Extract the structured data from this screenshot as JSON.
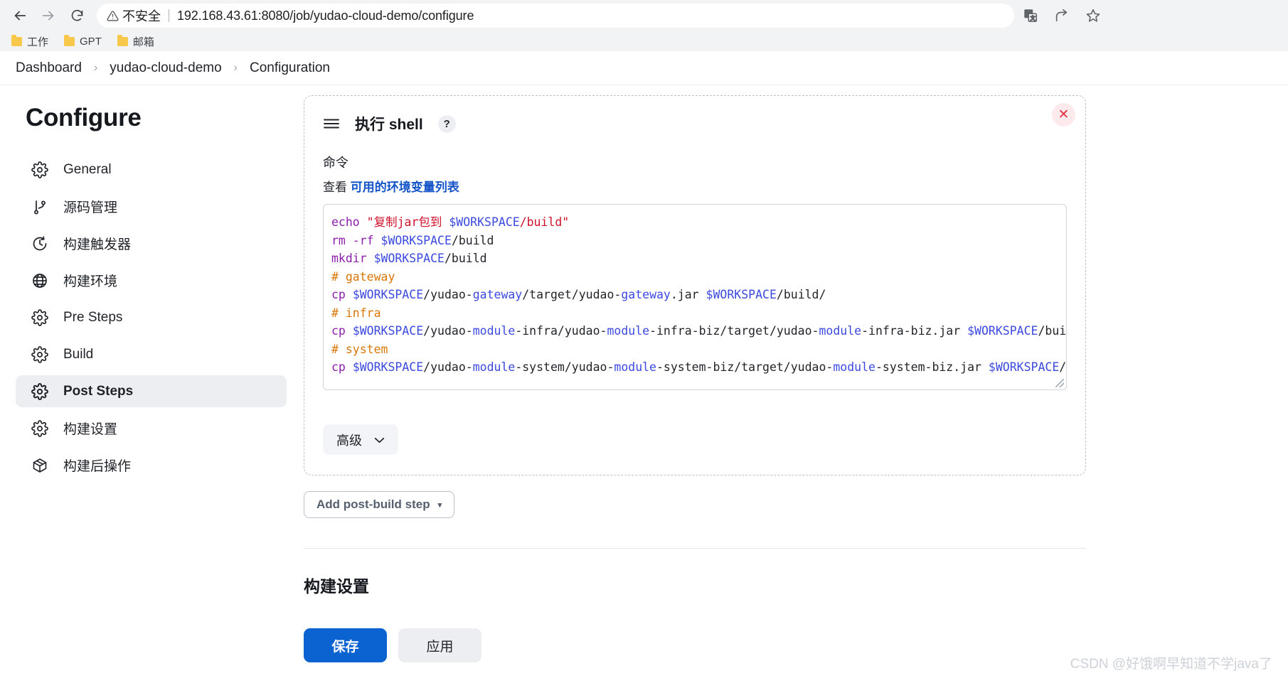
{
  "browser": {
    "back_icon": "back-arrow-icon",
    "forward_icon": "forward-arrow-icon",
    "reload_icon": "reload-icon",
    "security_label": "不安全",
    "url": "192.168.43.61:8080/job/yudao-cloud-demo/configure",
    "separator": "|",
    "actions": [
      {
        "name": "translate-icon",
        "glyph": "translate"
      },
      {
        "name": "share-icon",
        "glyph": "share"
      },
      {
        "name": "bookmark-star-icon",
        "glyph": "star"
      }
    ],
    "bookmarks": [
      {
        "label": "工作"
      },
      {
        "label": "GPT"
      },
      {
        "label": "邮箱"
      }
    ]
  },
  "breadcrumb": {
    "separator": "›",
    "items": [
      {
        "label": "Dashboard"
      },
      {
        "label": "yudao-cloud-demo"
      },
      {
        "label": "Configuration"
      }
    ]
  },
  "sidebar": {
    "title": "Configure",
    "items": [
      {
        "label": "General",
        "icon": "gear-icon",
        "active": false
      },
      {
        "label": "源码管理",
        "icon": "git-branch-icon",
        "active": false
      },
      {
        "label": "构建触发器",
        "icon": "clock-icon",
        "active": false
      },
      {
        "label": "构建环境",
        "icon": "globe-icon",
        "active": false
      },
      {
        "label": "Pre Steps",
        "icon": "gear-icon",
        "active": false
      },
      {
        "label": "Build",
        "icon": "gear-icon",
        "active": false
      },
      {
        "label": "Post Steps",
        "icon": "gear-icon",
        "active": true
      },
      {
        "label": "构建设置",
        "icon": "gear-icon",
        "active": false
      },
      {
        "label": "构建后操作",
        "icon": "package-icon",
        "active": false
      }
    ]
  },
  "step_card": {
    "drag_icon": "drag-handle-icon",
    "title": "执行 shell",
    "help_badge": "?",
    "close_icon": "✕",
    "command_label": "命令",
    "hint_prefix": "查看",
    "hint_link": "可用的环境变量列表",
    "command_lines": [
      [
        {
          "t": "echo ",
          "c": "cmd"
        },
        {
          "t": "\"复制jar包到 ",
          "c": "str"
        },
        {
          "t": "$WORKSPACE",
          "c": "var"
        },
        {
          "t": "/build\"",
          "c": "str"
        }
      ],
      [
        {
          "t": "rm -rf ",
          "c": "cmd"
        },
        {
          "t": "$WORKSPACE",
          "c": "var"
        },
        {
          "t": "/build",
          "c": "plain"
        }
      ],
      [
        {
          "t": "mkdir ",
          "c": "cmd"
        },
        {
          "t": "$WORKSPACE",
          "c": "var"
        },
        {
          "t": "/build",
          "c": "plain"
        }
      ],
      [
        {
          "t": "# gateway",
          "c": "cmt"
        }
      ],
      [
        {
          "t": "cp ",
          "c": "cmd"
        },
        {
          "t": "$WORKSPACE",
          "c": "var"
        },
        {
          "t": "/yudao-",
          "c": "plain"
        },
        {
          "t": "gateway",
          "c": "var"
        },
        {
          "t": "/target/yudao-",
          "c": "plain"
        },
        {
          "t": "gateway",
          "c": "var"
        },
        {
          "t": ".jar ",
          "c": "plain"
        },
        {
          "t": "$WORKSPACE",
          "c": "var"
        },
        {
          "t": "/build/",
          "c": "plain"
        }
      ],
      [
        {
          "t": "# infra",
          "c": "cmt"
        }
      ],
      [
        {
          "t": "cp ",
          "c": "cmd"
        },
        {
          "t": "$WORKSPACE",
          "c": "var"
        },
        {
          "t": "/yudao-",
          "c": "plain"
        },
        {
          "t": "module",
          "c": "var"
        },
        {
          "t": "-infra/yudao-",
          "c": "plain"
        },
        {
          "t": "module",
          "c": "var"
        },
        {
          "t": "-infra-biz/target/yudao-",
          "c": "plain"
        },
        {
          "t": "module",
          "c": "var"
        },
        {
          "t": "-infra-biz.jar ",
          "c": "plain"
        },
        {
          "t": "$WORKSPACE",
          "c": "var"
        },
        {
          "t": "/build/",
          "c": "plain"
        }
      ],
      [
        {
          "t": "# system",
          "c": "cmt"
        }
      ],
      [
        {
          "t": "cp ",
          "c": "cmd"
        },
        {
          "t": "$WORKSPACE",
          "c": "var"
        },
        {
          "t": "/yudao-",
          "c": "plain"
        },
        {
          "t": "module",
          "c": "var"
        },
        {
          "t": "-system/yudao-",
          "c": "plain"
        },
        {
          "t": "module",
          "c": "var"
        },
        {
          "t": "-system-biz/target/yudao-",
          "c": "plain"
        },
        {
          "t": "module",
          "c": "var"
        },
        {
          "t": "-system-biz.jar ",
          "c": "plain"
        },
        {
          "t": "$WORKSPACE",
          "c": "var"
        },
        {
          "t": "/build/",
          "c": "plain"
        }
      ]
    ],
    "advanced_label": "高级",
    "advanced_chevron": "⌄"
  },
  "main": {
    "add_step_label": "Add post-build step",
    "add_step_caret": "▾",
    "section_title": "构建设置",
    "save_label": "保存",
    "apply_label": "应用"
  },
  "watermark": "CSDN @好饿啊早知道不学java了",
  "colors": {
    "accent": "#0b62d1",
    "link": "#1454c8",
    "close": "#e23146",
    "active_bg": "#eceef2"
  }
}
